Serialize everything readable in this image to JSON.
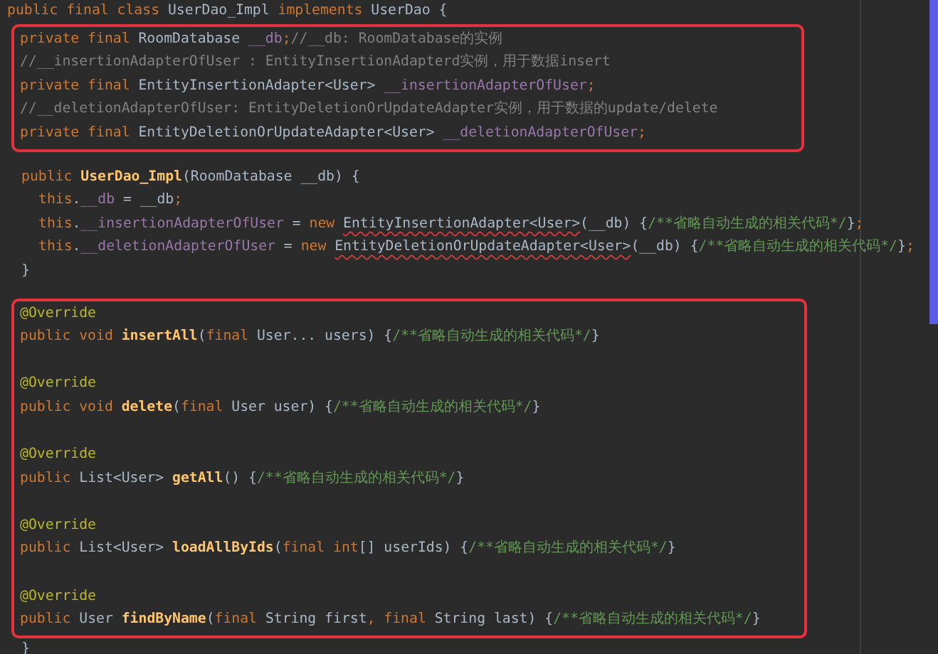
{
  "editor": {
    "blocks": [
      {
        "kind": "plain",
        "groups": [
          [
            {
              "tokens": [
                {
                  "kind": "keyword",
                  "text": "public final class "
                },
                {
                  "kind": "plain",
                  "text": "UserDao_Impl "
                },
                {
                  "kind": "keyword",
                  "text": "implements "
                },
                {
                  "kind": "plain",
                  "text": "UserDao {"
                }
              ]
            }
          ]
        ]
      },
      {
        "kind": "boxed",
        "groups": [
          [
            {
              "tokens": [
                {
                  "kind": "keyword",
                  "text": "private final "
                },
                {
                  "kind": "plain",
                  "text": "RoomDatabase "
                },
                {
                  "kind": "field",
                  "text": "__db"
                },
                {
                  "kind": "keyword",
                  "text": ";"
                },
                {
                  "kind": "comment",
                  "text": "//__db: RoomDatabase的实例"
                }
              ]
            },
            {
              "tokens": [
                {
                  "kind": "comment",
                  "text": "//__insertionAdapterOfUser : EntityInsertionAdapterd实例，用于数据insert"
                }
              ]
            },
            {
              "tokens": [
                {
                  "kind": "keyword",
                  "text": "private final "
                },
                {
                  "kind": "plain",
                  "text": "EntityInsertionAdapter<User> "
                },
                {
                  "kind": "field",
                  "text": "__insertionAdapterOfUser"
                },
                {
                  "kind": "keyword",
                  "text": ";"
                }
              ]
            },
            {
              "tokens": [
                {
                  "kind": "comment",
                  "text": "//__deletionAdapterOfUser: EntityDeletionOrUpdateAdapter实例，用于数据的update/delete"
                }
              ]
            },
            {
              "tokens": [
                {
                  "kind": "keyword",
                  "text": "private final "
                },
                {
                  "kind": "plain",
                  "text": "EntityDeletionOrUpdateAdapter<User> "
                },
                {
                  "kind": "field",
                  "text": "__deletionAdapterOfUser"
                },
                {
                  "kind": "keyword",
                  "text": ";"
                }
              ]
            }
          ]
        ]
      },
      {
        "kind": "plain",
        "groups": [
          [
            {
              "tokens": [
                {
                  "kind": "keyword",
                  "text": "public "
                },
                {
                  "kind": "method",
                  "text": "UserDao_Impl"
                },
                {
                  "kind": "plain",
                  "text": "(RoomDatabase __db) {"
                }
              ],
              "children": [
                {
                  "tokens": [
                    {
                      "kind": "keyword",
                      "text": "this"
                    },
                    {
                      "kind": "plain",
                      "text": "."
                    },
                    {
                      "kind": "field",
                      "text": "__db"
                    },
                    {
                      "kind": "plain",
                      "text": " = __db"
                    },
                    {
                      "kind": "keyword",
                      "text": ";"
                    }
                  ]
                },
                {
                  "tokens": [
                    {
                      "kind": "keyword",
                      "text": "this"
                    },
                    {
                      "kind": "plain",
                      "text": "."
                    },
                    {
                      "kind": "field",
                      "text": "__insertionAdapterOfUser"
                    },
                    {
                      "kind": "plain",
                      "text": " = "
                    },
                    {
                      "kind": "keyword",
                      "text": "new "
                    },
                    {
                      "kind": "error",
                      "text": "EntityInsertionAdapter<User>"
                    },
                    {
                      "kind": "plain",
                      "text": "(__db) {"
                    },
                    {
                      "kind": "doc",
                      "text": "/**省略自动生成的相关代码*/"
                    },
                    {
                      "kind": "plain",
                      "text": "}"
                    },
                    {
                      "kind": "keyword",
                      "text": ";"
                    }
                  ]
                },
                {
                  "tokens": [
                    {
                      "kind": "keyword",
                      "text": "this"
                    },
                    {
                      "kind": "plain",
                      "text": "."
                    },
                    {
                      "kind": "field",
                      "text": "__deletionAdapterOfUser"
                    },
                    {
                      "kind": "plain",
                      "text": " = "
                    },
                    {
                      "kind": "keyword",
                      "text": "new "
                    },
                    {
                      "kind": "error",
                      "text": "EntityDeletionOrUpdateAdapter<User>"
                    },
                    {
                      "kind": "plain",
                      "text": "(__db) {"
                    },
                    {
                      "kind": "doc",
                      "text": "/**省略自动生成的相关代码*/"
                    },
                    {
                      "kind": "plain",
                      "text": "}"
                    },
                    {
                      "kind": "keyword",
                      "text": ";"
                    }
                  ]
                }
              ]
            },
            {
              "tokens": [
                {
                  "kind": "plain",
                  "text": "}"
                }
              ]
            }
          ]
        ]
      },
      {
        "kind": "boxed",
        "groups": [
          [
            {
              "tokens": [
                {
                  "kind": "annotation",
                  "text": "@Override"
                }
              ]
            },
            {
              "tokens": [
                {
                  "kind": "keyword",
                  "text": "public void "
                },
                {
                  "kind": "method",
                  "text": "insertAll"
                },
                {
                  "kind": "plain",
                  "text": "("
                },
                {
                  "kind": "keyword",
                  "text": "final "
                },
                {
                  "kind": "plain",
                  "text": "User... users) {"
                },
                {
                  "kind": "doc",
                  "text": "/**省略自动生成的相关代码*/"
                },
                {
                  "kind": "plain",
                  "text": "}"
                }
              ]
            }
          ],
          [
            {
              "tokens": [
                {
                  "kind": "annotation",
                  "text": "@Override"
                }
              ]
            },
            {
              "tokens": [
                {
                  "kind": "keyword",
                  "text": "public void "
                },
                {
                  "kind": "method",
                  "text": "delete"
                },
                {
                  "kind": "plain",
                  "text": "("
                },
                {
                  "kind": "keyword",
                  "text": "final "
                },
                {
                  "kind": "plain",
                  "text": "User user) {"
                },
                {
                  "kind": "doc",
                  "text": "/**省略自动生成的相关代码*/"
                },
                {
                  "kind": "plain",
                  "text": "}"
                }
              ]
            }
          ],
          [
            {
              "tokens": [
                {
                  "kind": "annotation",
                  "text": "@Override"
                }
              ]
            },
            {
              "tokens": [
                {
                  "kind": "keyword",
                  "text": "public "
                },
                {
                  "kind": "plain",
                  "text": "List<User> "
                },
                {
                  "kind": "method",
                  "text": "getAll"
                },
                {
                  "kind": "plain",
                  "text": "() {"
                },
                {
                  "kind": "doc",
                  "text": "/**省略自动生成的相关代码*/"
                },
                {
                  "kind": "plain",
                  "text": "}"
                }
              ]
            }
          ],
          [
            {
              "tokens": [
                {
                  "kind": "annotation",
                  "text": "@Override"
                }
              ]
            },
            {
              "tokens": [
                {
                  "kind": "keyword",
                  "text": "public "
                },
                {
                  "kind": "plain",
                  "text": "List<User> "
                },
                {
                  "kind": "method",
                  "text": "loadAllByIds"
                },
                {
                  "kind": "plain",
                  "text": "("
                },
                {
                  "kind": "keyword",
                  "text": "final int"
                },
                {
                  "kind": "plain",
                  "text": "[] userIds) {"
                },
                {
                  "kind": "doc",
                  "text": "/**省略自动生成的相关代码*/"
                },
                {
                  "kind": "plain",
                  "text": "}"
                }
              ]
            }
          ],
          [
            {
              "tokens": [
                {
                  "kind": "annotation",
                  "text": "@Override"
                }
              ]
            },
            {
              "tokens": [
                {
                  "kind": "keyword",
                  "text": "public "
                },
                {
                  "kind": "plain",
                  "text": "User "
                },
                {
                  "kind": "method",
                  "text": "findByName"
                },
                {
                  "kind": "plain",
                  "text": "("
                },
                {
                  "kind": "keyword",
                  "text": "final "
                },
                {
                  "kind": "plain",
                  "text": "String first"
                },
                {
                  "kind": "keyword",
                  "text": ", final "
                },
                {
                  "kind": "plain",
                  "text": "String last) {"
                },
                {
                  "kind": "doc",
                  "text": "/**省略自动生成的相关代码*/"
                },
                {
                  "kind": "plain",
                  "text": "}"
                }
              ]
            }
          ]
        ]
      },
      {
        "kind": "plain",
        "groups": [
          [
            {
              "tokens": [
                {
                  "kind": "plain",
                  "text": "}"
                }
              ]
            }
          ]
        ]
      }
    ]
  }
}
